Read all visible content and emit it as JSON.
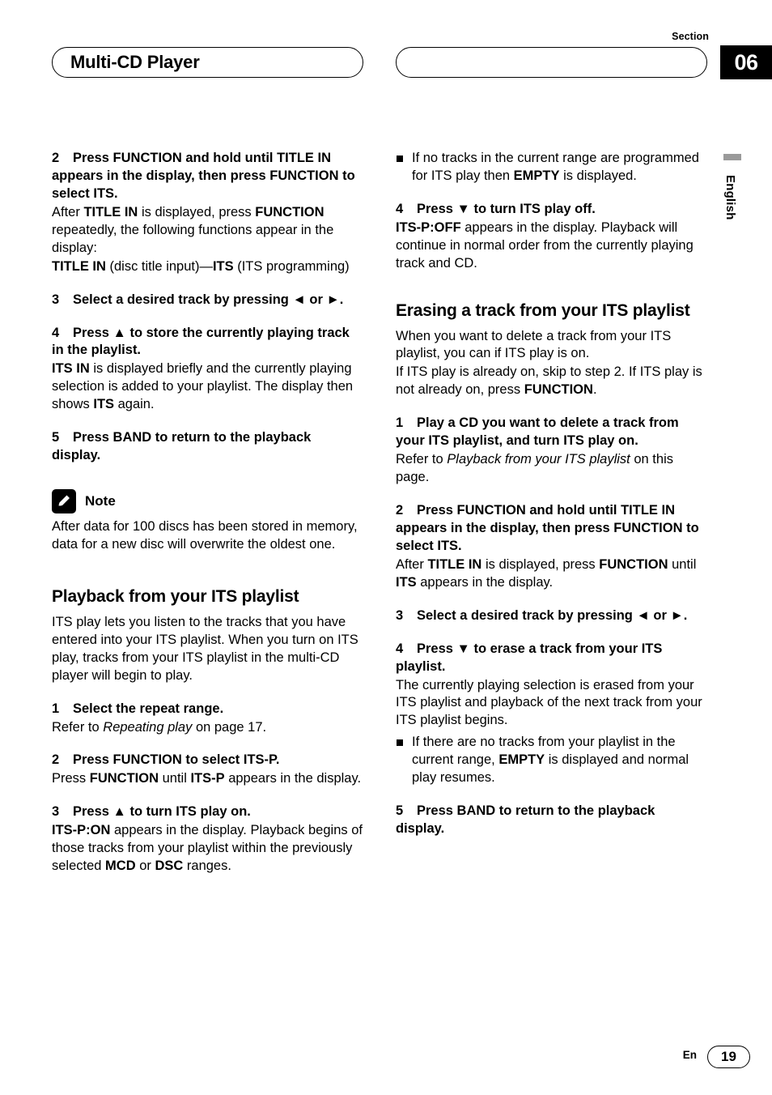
{
  "header": {
    "section_label": "Section",
    "section_number": "06",
    "title": "Multi-CD Player"
  },
  "side_tab": {
    "language": "English"
  },
  "left_column": {
    "step2_head": "Press FUNCTION and hold until TITLE IN appears in the display, then press FUNCTION to select ITS.",
    "step2_num": "2",
    "step2_body_1": "After ",
    "step2_body_b1": "TITLE IN",
    "step2_body_2": " is displayed, press ",
    "step2_body_b2": "FUNCTION",
    "step2_body_3": " repeatedly, the following functions appear in the display:",
    "step2_body_b3": "TITLE IN",
    "step2_body_4": " (disc title input)—",
    "step2_body_b4": "ITS",
    "step2_body_5": " (ITS programming)",
    "step3_num": "3",
    "step3_head": "Select a desired track by pressing ◄ or ►.",
    "step4_num": "4",
    "step4_head": "Press ▲ to store the currently playing track in the playlist.",
    "step4_body_b1": "ITS IN",
    "step4_body_1": " is displayed briefly and the currently playing selection is added to your playlist. The display then shows ",
    "step4_body_b2": "ITS",
    "step4_body_2": " again.",
    "step5_num": "5",
    "step5_head": "Press BAND to return to the playback display.",
    "note_label": "Note",
    "note_body": "After data for 100 discs has been stored in memory, data for a new disc will overwrite the oldest one.",
    "heading_playback": "Playback from your ITS playlist",
    "playback_intro": "ITS play lets you listen to the tracks that you have entered into your ITS playlist. When you turn on ITS play, tracks from your ITS playlist in the multi-CD player will begin to play.",
    "p_step1_num": "1",
    "p_step1_head": "Select the repeat range.",
    "p_step1_body_1": "Refer to ",
    "p_step1_body_i": "Repeating play",
    "p_step1_body_2": " on page 17.",
    "p_step2_num": "2",
    "p_step2_head": "Press FUNCTION to select ITS-P.",
    "p_step2_body_1": "Press ",
    "p_step2_body_b1": "FUNCTION",
    "p_step2_body_2": " until ",
    "p_step2_body_b2": "ITS-P",
    "p_step2_body_3": " appears in the display.",
    "p_step3_num": "3",
    "p_step3_head": "Press ▲ to turn ITS play on.",
    "p_step3_body_b1": "ITS-P:ON",
    "p_step3_body_1": " appears in the display. Playback begins of those tracks from your playlist within the previously selected ",
    "p_step3_body_b2": "MCD",
    "p_step3_body_2": " or ",
    "p_step3_body_b3": "DSC",
    "p_step3_body_3": " ranges."
  },
  "right_column": {
    "bullet1_1": "If no tracks in the current range are programmed for ITS play then ",
    "bullet1_b": "EMPTY",
    "bullet1_2": " is displayed.",
    "step4_num": "4",
    "step4_head": "Press ▼ to turn ITS play off.",
    "step4_body_b": "ITS-P:OFF",
    "step4_body_1": " appears in the display. Playback will continue in normal order from the currently playing track and CD.",
    "heading_erasing": "Erasing a track from your ITS playlist",
    "erasing_intro_1": "When you want to delete a track from your ITS playlist, you can if ITS play is on.",
    "erasing_intro_2": "If ITS play is already on, skip to step 2. If ITS play is not already on, press ",
    "erasing_intro_b": "FUNCTION",
    "erasing_intro_3": ".",
    "e_step1_num": "1",
    "e_step1_head": "Play a CD you want to delete a track from your ITS playlist, and turn ITS play on.",
    "e_step1_body_1": "Refer to ",
    "e_step1_body_i": "Playback from your ITS playlist",
    "e_step1_body_2": " on this page.",
    "e_step2_num": "2",
    "e_step2_head": "Press FUNCTION and hold until TITLE IN appears in the display, then press FUNCTION to select ITS.",
    "e_step2_body_1": "After ",
    "e_step2_body_b1": "TITLE IN",
    "e_step2_body_2": " is displayed, press ",
    "e_step2_body_b2": "FUNCTION",
    "e_step2_body_3": " until ",
    "e_step2_body_b3": "ITS",
    "e_step2_body_4": " appears in the display.",
    "e_step3_num": "3",
    "e_step3_head": "Select a desired track by pressing ◄ or ►.",
    "e_step4_num": "4",
    "e_step4_head": "Press ▼ to erase a track from your ITS playlist.",
    "e_step4_body": "The currently playing selection is erased from your ITS playlist and playback of the next track from your ITS playlist begins.",
    "e_bullet_1": "If there are no tracks from your playlist in the current range, ",
    "e_bullet_b": "EMPTY",
    "e_bullet_2": " is displayed and normal play resumes.",
    "e_step5_num": "5",
    "e_step5_head": "Press BAND to return to the playback display."
  },
  "footer": {
    "lang": "En",
    "page": "19"
  }
}
